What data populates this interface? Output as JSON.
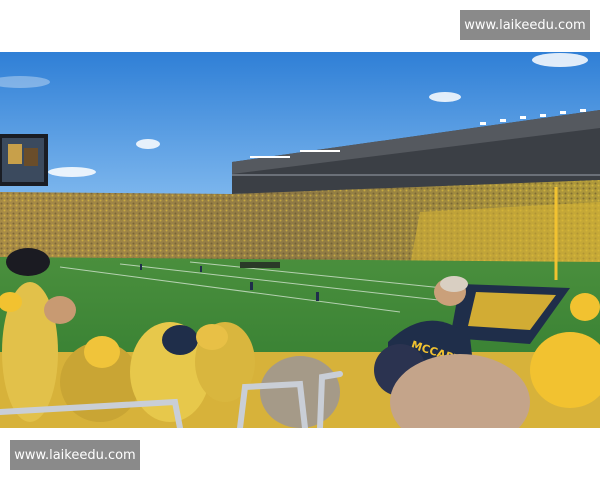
{
  "watermarks": {
    "top_right": "www.laikeedu.com",
    "bottom_left": "www.laikeedu.com"
  },
  "photo": {
    "jersey_name": "MCCARTNEY"
  },
  "colors": {
    "sky": "#3d8fe0",
    "field": "#3f8a3a",
    "maize": "#f2c230",
    "navy": "#1f2e4a"
  }
}
